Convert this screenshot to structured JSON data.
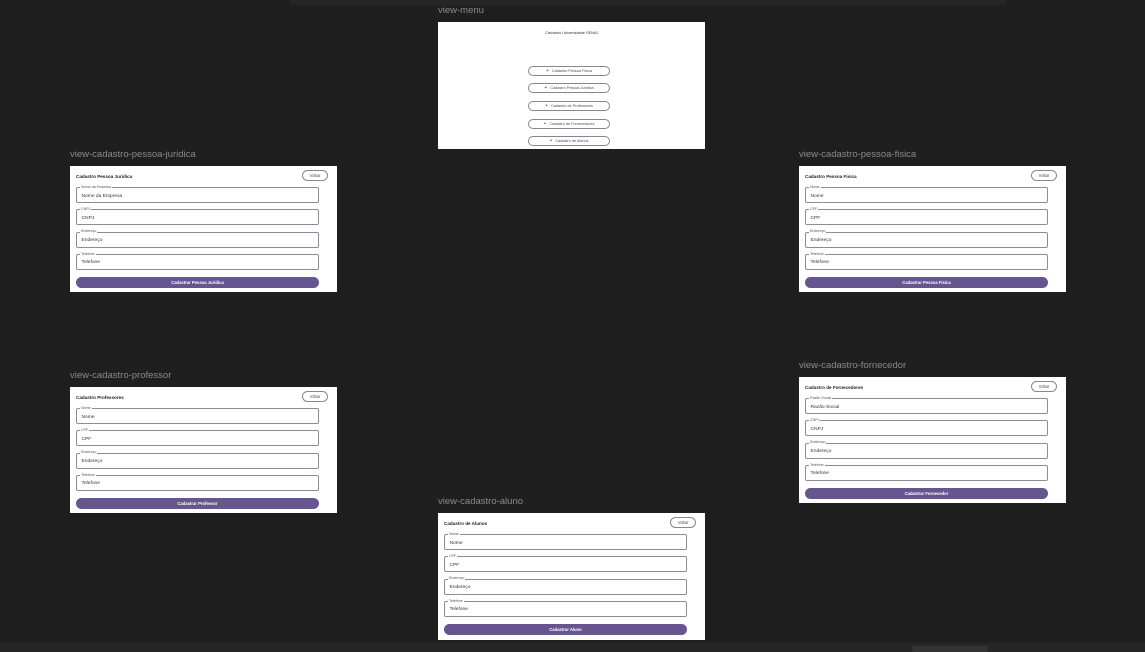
{
  "frames": {
    "menu": {
      "label": "view-menu",
      "title": "Cadastro Universidade SENAI",
      "buttons": [
        {
          "icon": "plus-icon",
          "glyph": "+",
          "label": "Cadastro Pessoa Fisica"
        },
        {
          "icon": "plus-icon",
          "glyph": "+",
          "label": "Cadastro Pessoa Juridica"
        },
        {
          "icon": "plus-icon",
          "glyph": "+",
          "label": "Cadastro de Professores"
        },
        {
          "icon": "plus-icon",
          "glyph": "+",
          "label": "Cadastro de Fornecedores"
        },
        {
          "icon": "plus-icon",
          "glyph": "+",
          "label": "Cadastro de Alunos"
        }
      ]
    },
    "juridica": {
      "label": "view-cadastro-pessoa-juridica",
      "title": "Cadastro Pessoa Juridica",
      "back": "Voltar",
      "fields": [
        {
          "label": "Nome da Empresa",
          "placeholder": "Nome da Empresa"
        },
        {
          "label": "CNPJ",
          "placeholder": "CNPJ"
        },
        {
          "label": "Endereço",
          "placeholder": "Endereço"
        },
        {
          "label": "Telefone",
          "placeholder": "Telefone"
        }
      ],
      "submit": "Cadastrar Pessoa Juridica"
    },
    "fisica": {
      "label": "view-cadastro-pessoa-fisica",
      "title": "Cadastro Pessoa Fisica",
      "back": "Voltar",
      "fields": [
        {
          "label": "Nome",
          "placeholder": "Nome"
        },
        {
          "label": "CPF",
          "placeholder": "CPF"
        },
        {
          "label": "Endereço",
          "placeholder": "Endereço"
        },
        {
          "label": "Telefone",
          "placeholder": "Telefone"
        }
      ],
      "submit": "Cadastrar Pessoa Fisica"
    },
    "professor": {
      "label": "view-cadastro-professor",
      "title": "Cadastro Professores",
      "back": "Voltar",
      "fields": [
        {
          "label": "Nome",
          "placeholder": "Nome"
        },
        {
          "label": "CPF",
          "placeholder": "CPF"
        },
        {
          "label": "Endereço",
          "placeholder": "Endereço"
        },
        {
          "label": "Telefone",
          "placeholder": "Telefone"
        }
      ],
      "submit": "Cadastrar Professor"
    },
    "fornecedor": {
      "label": "view-cadastro-fornecedor",
      "title": "Cadastro de Fornecedores",
      "back": "Voltar",
      "fields": [
        {
          "label": "Razão Social",
          "placeholder": "Razão Social"
        },
        {
          "label": "CNPJ",
          "placeholder": "CNPJ"
        },
        {
          "label": "Endereço",
          "placeholder": "Endereço"
        },
        {
          "label": "Telefone",
          "placeholder": "Telefone"
        }
      ],
      "submit": "Cadastrar Fornecedor"
    },
    "aluno": {
      "label": "view-cadastro-aluno",
      "title": "Cadastro de Alunos",
      "back": "Voltar",
      "fields": [
        {
          "label": "Nome",
          "placeholder": "Nome"
        },
        {
          "label": "CPF",
          "placeholder": "CPF"
        },
        {
          "label": "Endereço",
          "placeholder": "Endereço"
        },
        {
          "label": "Telefone",
          "placeholder": "Telefone"
        }
      ],
      "submit": "Cadastrar Aluno"
    }
  },
  "colors": {
    "canvas": "#1f1f1f",
    "primary": "#66558f",
    "outline": "#8f8a96",
    "frame_label": "#8a8a8a"
  }
}
